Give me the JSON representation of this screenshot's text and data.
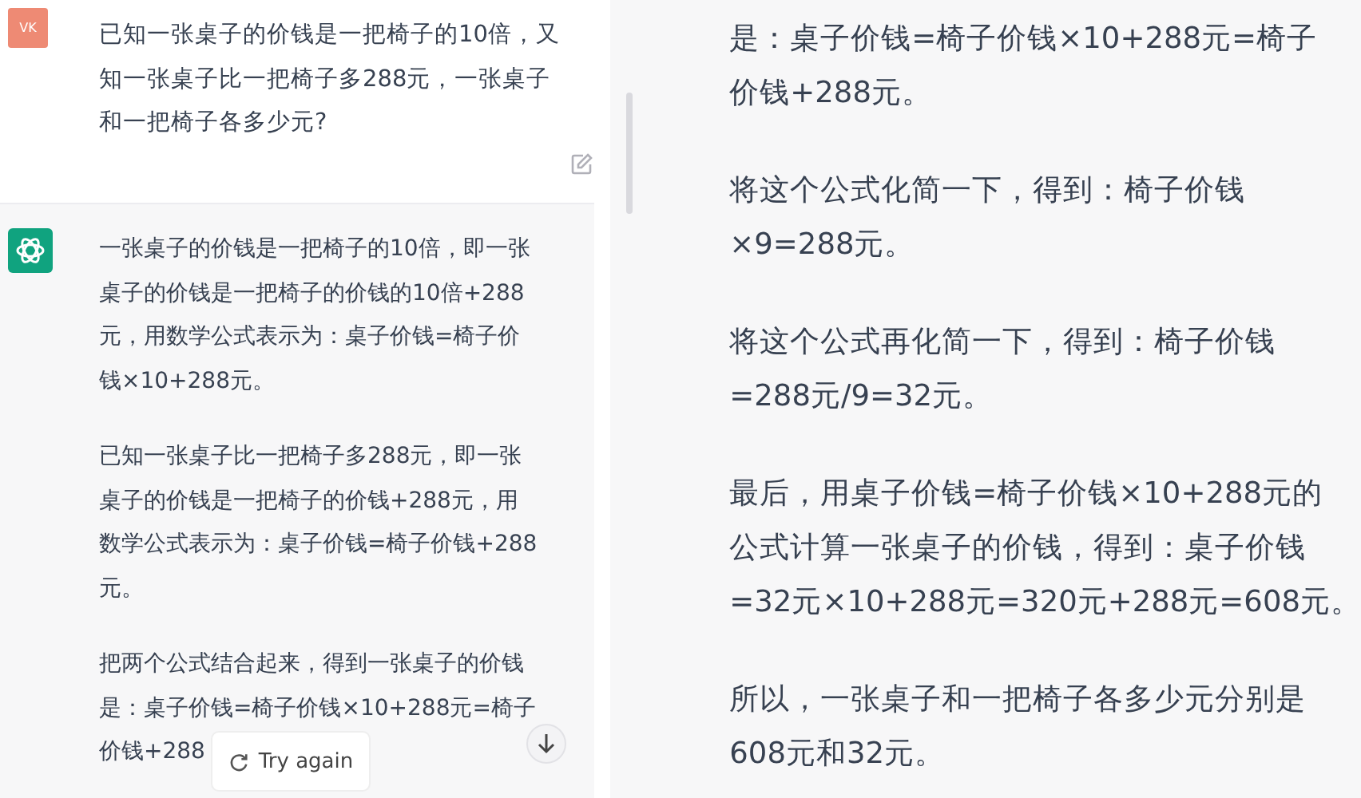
{
  "left_panel": {
    "user_message": {
      "avatar": "VK",
      "lines": [
        "已知一张桌子的价钱是一把椅子的10倍，又",
        "知一张桌子比一把椅子多288元，一张桌子",
        "和一把椅子各多少元?"
      ]
    },
    "assistant_message": {
      "paragraphs": [
        {
          "lines": [
            "一张桌子的价钱是一把椅子的10倍，即一张",
            "桌子的价钱是一把椅子的价钱的10倍+288",
            "元，用数学公式表示为：桌子价钱=椅子价",
            "钱×10+288元。"
          ]
        },
        {
          "lines": [
            "已知一张桌子比一把椅子多288元，即一张",
            "桌子的价钱是一把椅子的价钱+288元，用",
            "数学公式表示为：桌子价钱=椅子价钱+288",
            "元。"
          ]
        },
        {
          "lines": [
            "把两个公式结合起来，得到一张桌子的价钱",
            "是：桌子价钱=椅子价钱×10+288元=椅子",
            "价钱+288"
          ]
        }
      ]
    },
    "try_again_button": {
      "label": "Try again"
    }
  },
  "right_panel": {
    "paragraphs": [
      {
        "lines": [
          "是：桌子价钱=椅子价钱×10+288元=椅子",
          "价钱+288元。"
        ]
      },
      {
        "lines": [
          "将这个公式化简一下，得到：椅子价钱",
          "×9=288元。"
        ]
      },
      {
        "lines": [
          "将这个公式再化简一下，得到：椅子价钱",
          "=288元/9=32元。"
        ]
      },
      {
        "lines": [
          "最后，用桌子价钱=椅子价钱×10+288元的",
          "公式计算一张桌子的价钱，得到：桌子价钱",
          "=32元×10+288元=320元+288元=608元。"
        ]
      },
      {
        "lines": [
          "所以，一张桌子和一把椅子各多少元分别是",
          "608元和32元。"
        ]
      }
    ]
  }
}
